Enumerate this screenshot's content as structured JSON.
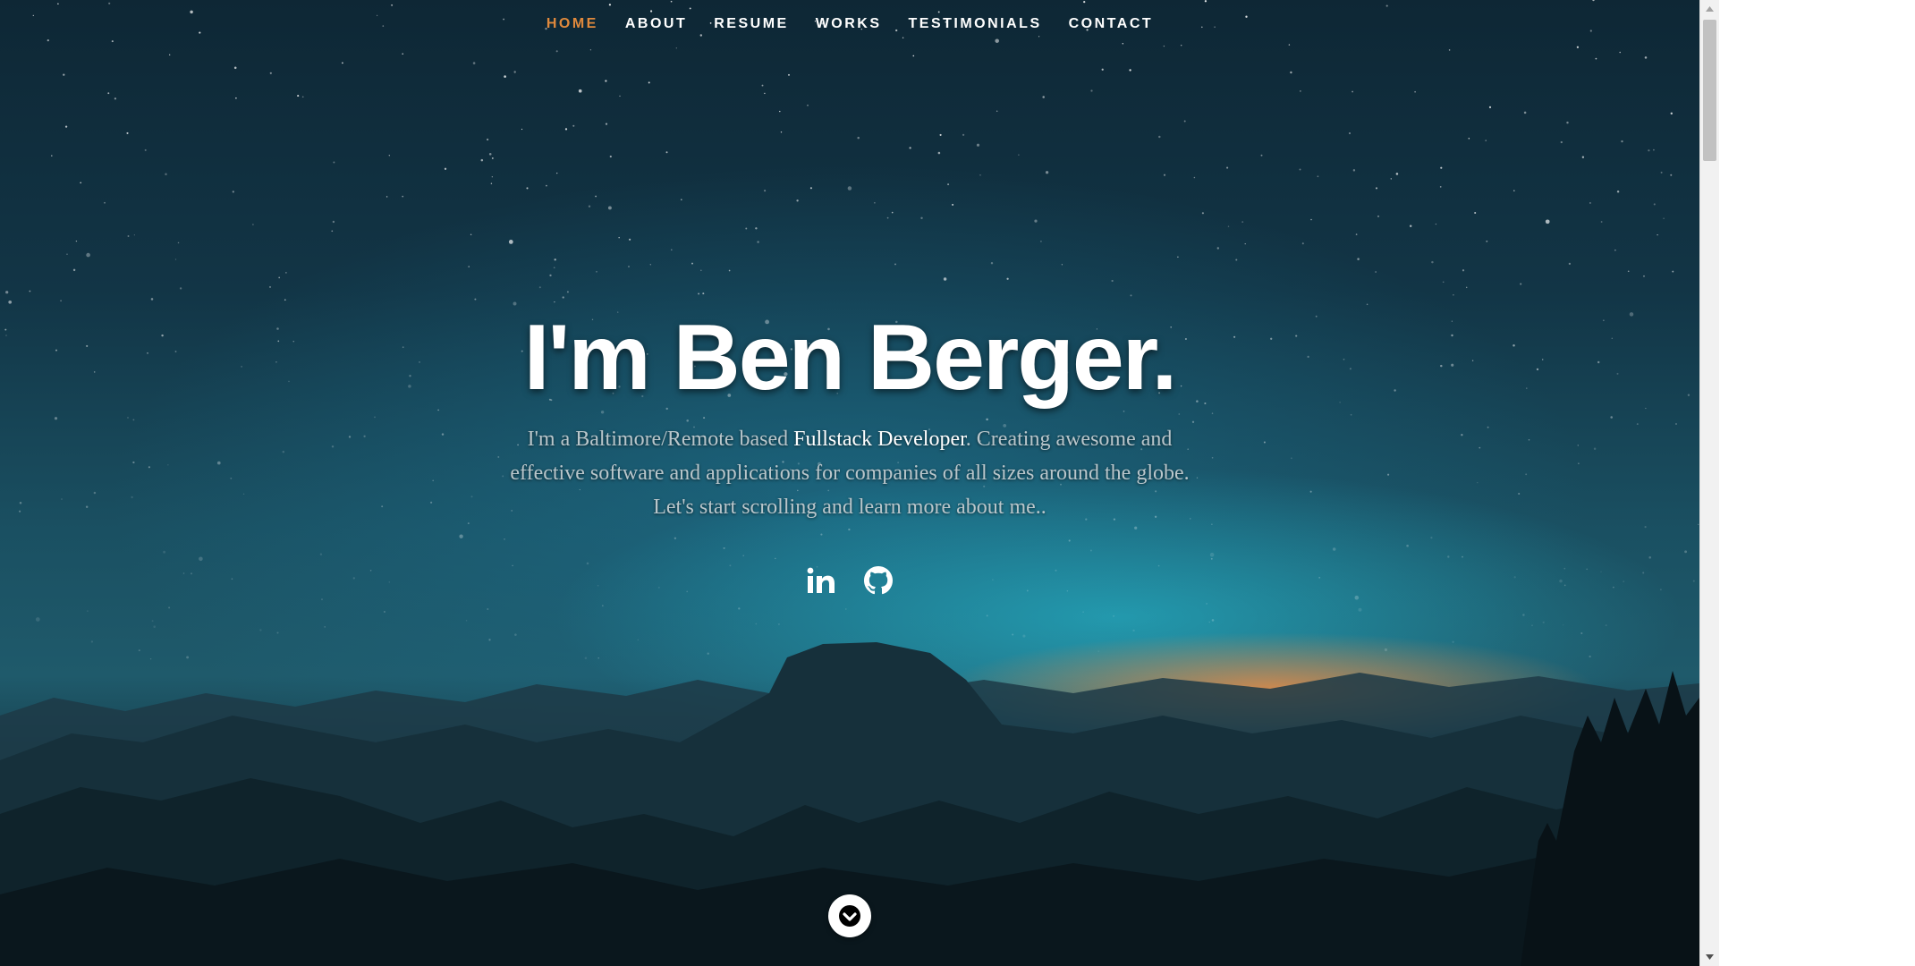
{
  "nav": {
    "items": [
      "HOME",
      "ABOUT",
      "RESUME",
      "WORKS",
      "TESTIMONIALS",
      "CONTACT"
    ],
    "active_index": 0
  },
  "banner": {
    "headline": "I'm Ben Berger.",
    "intro_before": "I'm a Baltimore/Remote based ",
    "intro_strong": "Fullstack Developer",
    "intro_after": ". Creating awesome and effective software and applications for companies of all sizes around the globe. Let's start scrolling and learn more about me.."
  },
  "social": [
    {
      "icon": "linkedin-icon"
    },
    {
      "icon": "github-icon"
    }
  ],
  "scroll": {
    "icon": "chevron-down-icon"
  },
  "colors": {
    "accent": "#e0893c",
    "text": "#ffffff",
    "intro_text": "#b9c6cb"
  }
}
